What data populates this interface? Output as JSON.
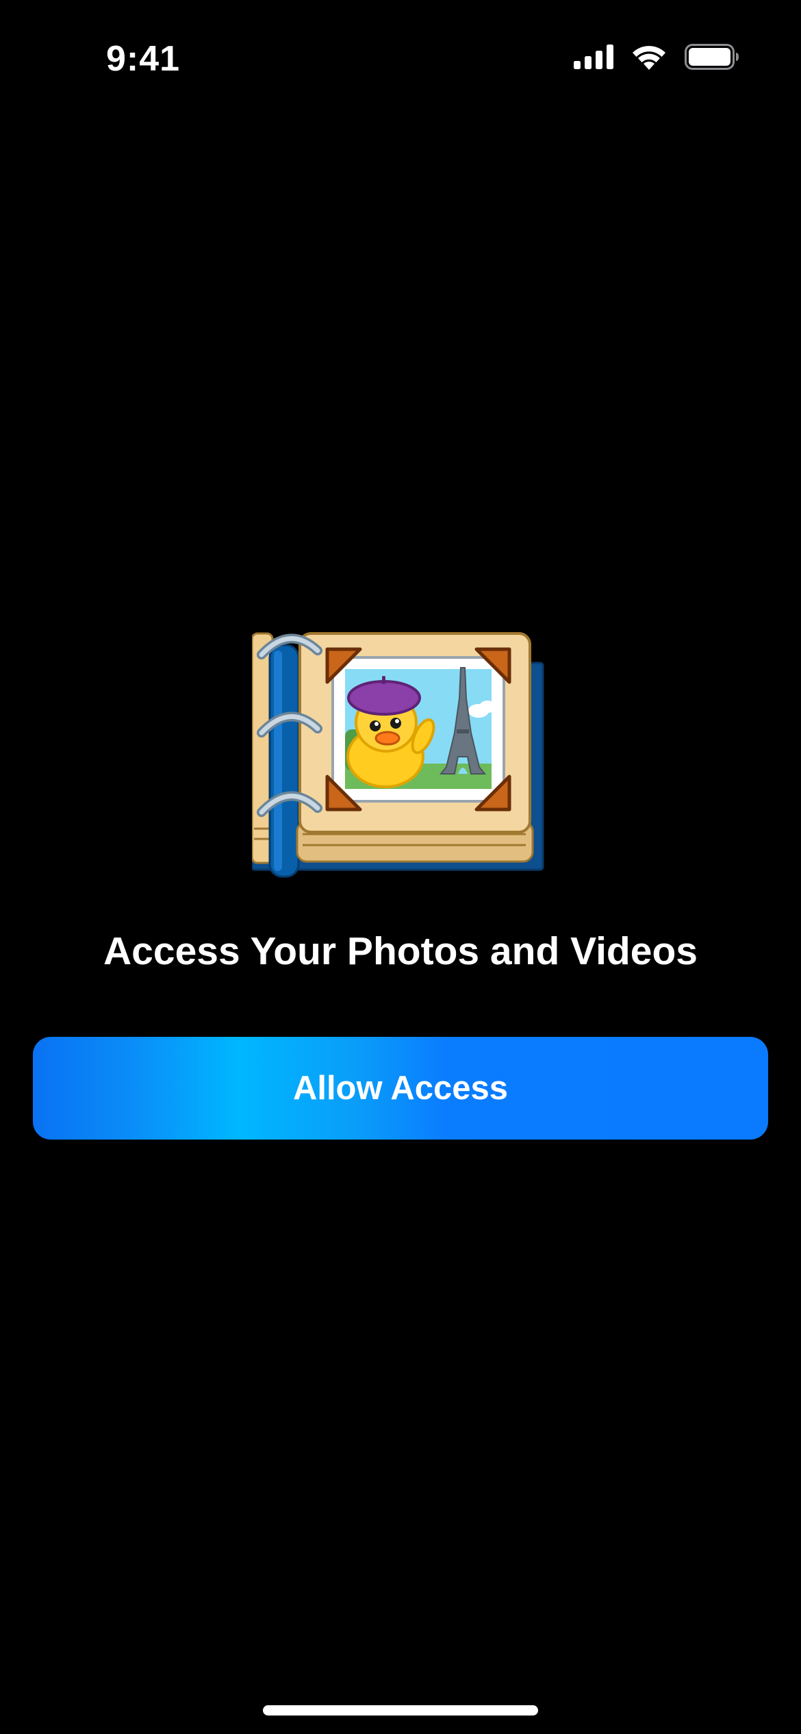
{
  "status_bar": {
    "time": "9:41",
    "icons": [
      "cellular-signal-icon",
      "wifi-icon",
      "battery-icon"
    ]
  },
  "illustration": {
    "icon": "photo-album-duck-icon"
  },
  "title": "Access Your Photos and Videos",
  "allow_button": {
    "label": "Allow Access"
  },
  "colors": {
    "background": "#000000",
    "accent": "#0A7AFF",
    "accent_highlight": "#00B7FF",
    "text": "#FFFFFF"
  }
}
